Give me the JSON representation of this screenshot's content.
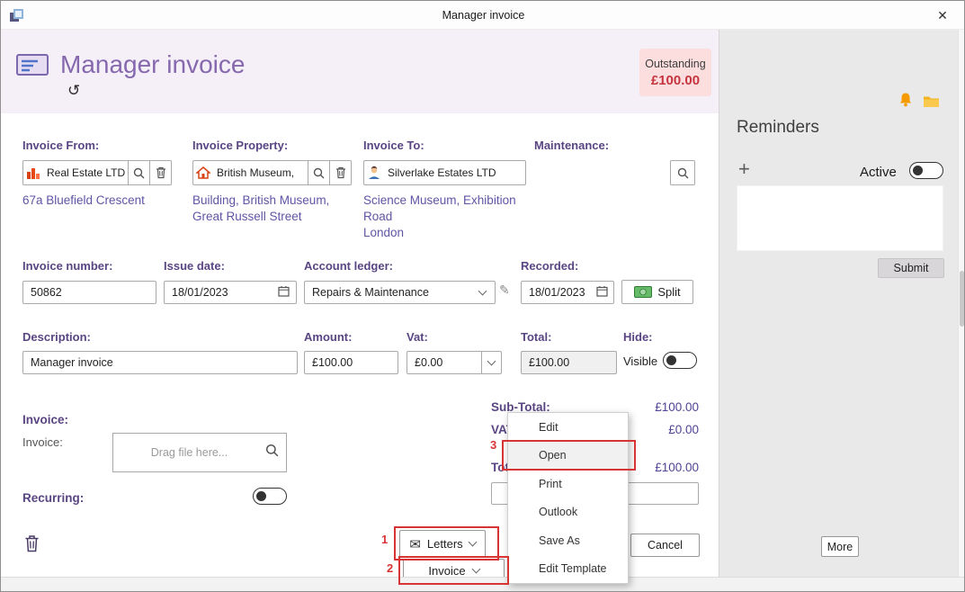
{
  "window": {
    "title": "Manager invoice"
  },
  "icons": {
    "close": "✕",
    "history": "↺",
    "pencil": "✎",
    "envelope": "✉",
    "plus": "+"
  },
  "header": {
    "title": "Manager invoice",
    "badge_label": "Outstanding",
    "badge_amount": "£100.00"
  },
  "fields": {
    "invoice_from": {
      "label": "Invoice From:",
      "value": "Real Estate LTD",
      "address": "67a Bluefield Crescent"
    },
    "invoice_property": {
      "label": "Invoice Property:",
      "value": "British Museum,",
      "address": "Building, British Museum, Great Russell Street"
    },
    "invoice_to": {
      "label": "Invoice To:",
      "value": "Silverlake Estates LTD",
      "address_line1": "Science Museum, Exhibition Road",
      "address_line2": "London"
    },
    "maintenance": {
      "label": "Maintenance:"
    },
    "invoice_number": {
      "label": "Invoice number:",
      "value": "50862"
    },
    "issue_date": {
      "label": "Issue date:",
      "value": "18/01/2023"
    },
    "account_ledger": {
      "label": "Account ledger:",
      "value": "Repairs & Maintenance"
    },
    "recorded": {
      "label": "Recorded:",
      "value": "18/01/2023"
    },
    "description": {
      "label": "Description:",
      "value": "Manager invoice"
    },
    "amount": {
      "label": "Amount:",
      "value": "£100.00"
    },
    "vat": {
      "label": "Vat:",
      "value": "£0.00"
    },
    "total": {
      "label": "Total:",
      "value": "£100.00"
    },
    "hide": {
      "label": "Hide:",
      "state": "Visible"
    },
    "invoice_section": {
      "header": "Invoice:",
      "label": "Invoice:",
      "drop_placeholder": "Drag file here..."
    },
    "recurring": {
      "label": "Recurring:"
    }
  },
  "totals": {
    "sub_total_label": "Sub-Total:",
    "sub_total": "£100.00",
    "vat_label": "VAT:",
    "vat": "£0.00",
    "total_label": "Total:",
    "total": "£100.00"
  },
  "buttons": {
    "split": "Split",
    "letters": "Letters",
    "invoice": "Invoice",
    "cancel": "Cancel",
    "submit": "Submit",
    "more": "More"
  },
  "context_menu": {
    "items": [
      "Edit",
      "Open",
      "Print",
      "Outlook",
      "Save As",
      "Edit Template"
    ]
  },
  "annotations": {
    "n1": "1",
    "n2": "2",
    "n3": "3"
  },
  "sidebar": {
    "title": "Reminders",
    "active_label": "Active"
  }
}
